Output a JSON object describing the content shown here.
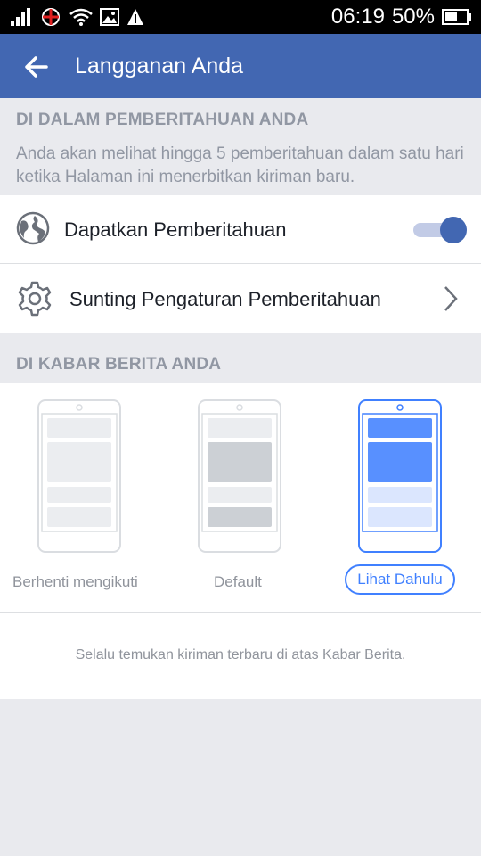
{
  "status_bar": {
    "time": "06:19",
    "battery": "50%",
    "icons": [
      "signal-icon",
      "carrier-icon",
      "wifi-icon",
      "image-icon",
      "warning-icon",
      "battery-icon"
    ]
  },
  "app_bar": {
    "title": "Langganan Anda",
    "color": "#4267b2"
  },
  "notifications_section": {
    "header": "DI DALAM PEMBERITAHUAN ANDA",
    "description": "Anda akan melihat hingga 5 pemberitahuan dalam satu hari ketika Halaman ini menerbitkan kiriman baru.",
    "items": {
      "get_notifications": {
        "label": "Dapatkan Pemberitahuan",
        "icon": "globe-icon",
        "enabled": true
      },
      "edit_settings": {
        "label": "Sunting Pengaturan Pemberitahuan",
        "icon": "gear-icon"
      }
    }
  },
  "news_feed_section": {
    "header": "DI KABAR BERITA ANDA",
    "options": {
      "unfollow": {
        "label": "Berhenti mengikuti",
        "selected": false
      },
      "default": {
        "label": "Default",
        "selected": false
      },
      "see_first": {
        "label": "Lihat Dahulu",
        "selected": true
      }
    },
    "caption": "Selalu temukan kiriman terbaru di atas Kabar Berita."
  },
  "colors": {
    "accent": "#4080ff",
    "brand": "#4267b2",
    "muted_text": "#90949c"
  }
}
